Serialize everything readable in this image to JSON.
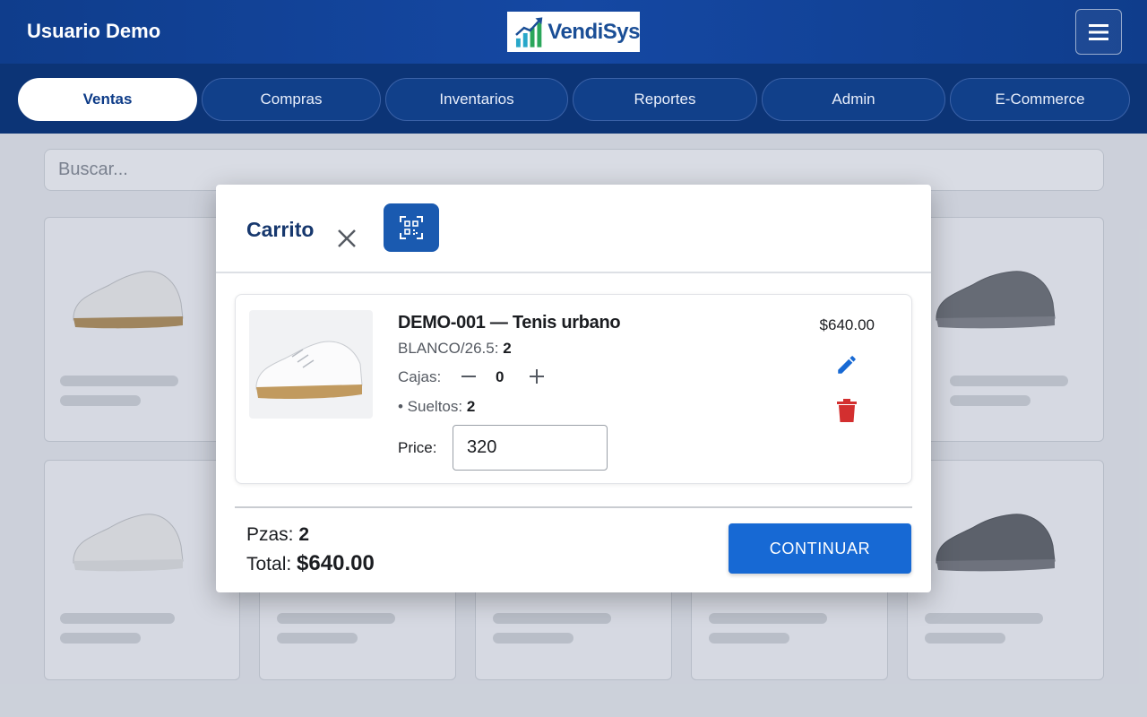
{
  "header": {
    "user_name": "Usuario Demo",
    "logo_text": "VendiSys",
    "menu_icon": "hamburger-menu-icon"
  },
  "tabs": [
    {
      "label": "Ventas",
      "active": true
    },
    {
      "label": "Compras",
      "active": false
    },
    {
      "label": "Inventarios",
      "active": false
    },
    {
      "label": "Reportes",
      "active": false
    },
    {
      "label": "Admin",
      "active": false
    },
    {
      "label": "E-Commerce",
      "active": false
    }
  ],
  "search": {
    "placeholder": "Buscar..."
  },
  "cart": {
    "title": "Carrito",
    "item": {
      "title": "DEMO-001 — Tenis urbano",
      "variant_label": "BLANCO/26.5:",
      "variant_qty": "2",
      "cajas_label": "Cajas:",
      "cajas_value": "0",
      "sueltos_label": "• Sueltos:",
      "sueltos_value": "2",
      "price_label": "Price:",
      "price_value": "320",
      "subtotal": "$640.00"
    },
    "summary": {
      "pzas_label": "Pzas:",
      "pzas_value": "2",
      "total_label": "Total:",
      "total_value": "$640.00"
    },
    "continue_label": "CONTINUAR"
  },
  "colors": {
    "header": "#0f3d8c",
    "tab_active_text": "#0e3c88",
    "primary_button": "#1769d4",
    "qr_button": "#1a5ab0",
    "delete": "#d32f2f",
    "edit": "#1769d4"
  }
}
